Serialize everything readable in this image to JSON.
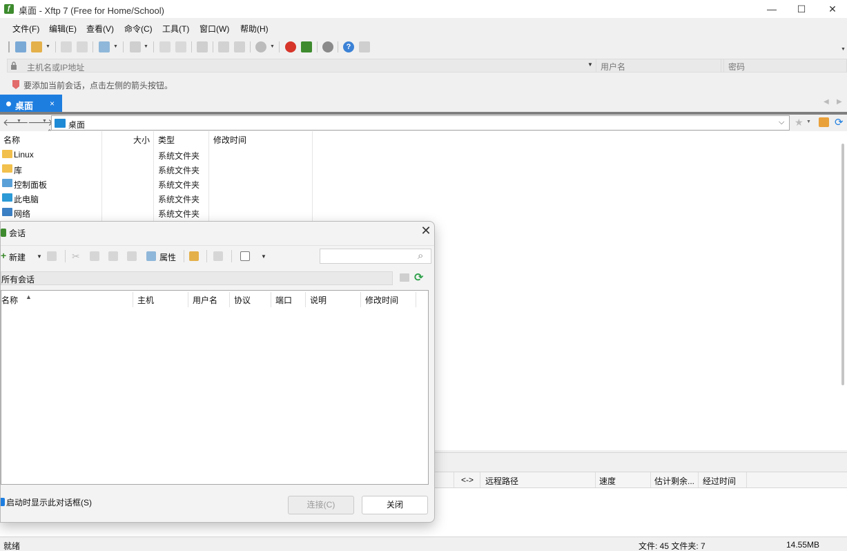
{
  "window": {
    "title": "桌面 - Xftp 7 (Free for Home/School)",
    "app_icon": "xftp-logo-icon",
    "minimize_glyph": "—",
    "maximize_glyph": "☐",
    "close_glyph": "✕"
  },
  "menu": [
    "文件(F)",
    "编辑(E)",
    "查看(V)",
    "命令(C)",
    "工具(T)",
    "窗口(W)",
    "帮助(H)"
  ],
  "address": {
    "host_placeholder": "主机名或IP地址",
    "username_placeholder": "用户名",
    "password_placeholder": "密码"
  },
  "hint": "要添加当前会话，点击左侧的箭头按钮。",
  "tabs": [
    {
      "label": "桌面",
      "close": "×"
    }
  ],
  "path": {
    "current": "桌面"
  },
  "file_pane": {
    "columns": [
      "名称",
      "大小",
      "类型",
      "修改时间"
    ],
    "rows": [
      {
        "name": "Linux",
        "type": "系统文件夹",
        "icon": "folder-icon"
      },
      {
        "name": "库",
        "type": "系统文件夹",
        "icon": "folder-icon"
      },
      {
        "name": "控制面板",
        "type": "系统文件夹",
        "icon": "control-panel-icon"
      },
      {
        "name": "此电脑",
        "type": "系统文件夹",
        "icon": "computer-icon"
      },
      {
        "name": "网络",
        "type": "系统文件夹",
        "icon": "network-icon"
      }
    ]
  },
  "transfer": {
    "columns": [
      "<->",
      "远程路径",
      "速度",
      "估计剩余...",
      "经过时间"
    ]
  },
  "status": {
    "left": "就绪",
    "counts": "文件: 45  文件夹: 7",
    "size": "14.55MB"
  },
  "dialog": {
    "title": "会话",
    "toolbar": {
      "new": "新建",
      "properties": "属性"
    },
    "filter": "所有会话",
    "columns": [
      "名称",
      "主机",
      "用户名",
      "协议",
      "端口",
      "说明",
      "修改时间"
    ],
    "checkbox_label": "启动时显示此对话框(S)",
    "connect_button": "连接(C)",
    "close_button": "关闭"
  },
  "colors": {
    "accent": "#1e7ee0",
    "brand": "#3d8b2e"
  }
}
